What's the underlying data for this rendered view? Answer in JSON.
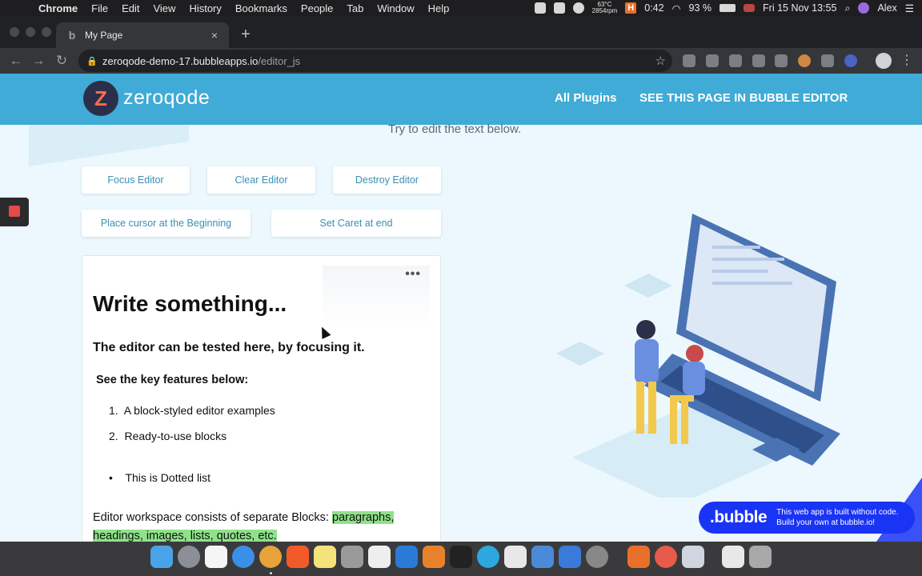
{
  "menubar": {
    "app_name": "Chrome",
    "items": [
      "File",
      "Edit",
      "View",
      "History",
      "Bookmarks",
      "People",
      "Tab",
      "Window",
      "Help"
    ],
    "temperature": "63°C",
    "fan": "2854rpm",
    "timer": "0:42",
    "battery": "93 %",
    "datetime": "Fri 15 Nov  13:55",
    "user": "Alex"
  },
  "browser": {
    "tab_title": "My Page",
    "url_host": "zeroqode-demo-17.bubbleapps.io",
    "url_path": "/editor_js"
  },
  "header": {
    "logo_text": "zeroqode",
    "nav": [
      "All Plugins",
      "SEE THIS PAGE IN BUBBLE EDITOR"
    ]
  },
  "page": {
    "subtitle": "Try to edit the text below.",
    "buttons": {
      "focus": "Focus Editor",
      "clear": "Clear Editor",
      "destroy": "Destroy Editor",
      "cursor_begin": "Place cursor at the Beginning",
      "caret_end": "Set Caret at end"
    }
  },
  "editor": {
    "heading": "Write something...",
    "subheading": "The editor can be tested here, by focusing it.",
    "features_title": "See the key features below:",
    "ordered_list": [
      {
        "num": "1.",
        "text": "A block-styled editor examples"
      },
      {
        "num": "2.",
        "text": "Ready-to-use blocks"
      }
    ],
    "bullet": "This is Dotted list",
    "paragraph_plain": "Editor workspace consists of separate Blocks: ",
    "paragraph_highlight": "paragraphs, headings, images, lists, quotes, etc."
  },
  "bubble_badge": {
    "logo": ".bubble",
    "line1": "This web app is built without code.",
    "line2": "Build your own at bubble.io!"
  },
  "colors": {
    "header": "#3fabd6",
    "page_bg": "#ecf8fd",
    "button_text": "#3a8fb4",
    "highlight": "#8fe28a",
    "bubble_blue": "#1a34f5"
  }
}
